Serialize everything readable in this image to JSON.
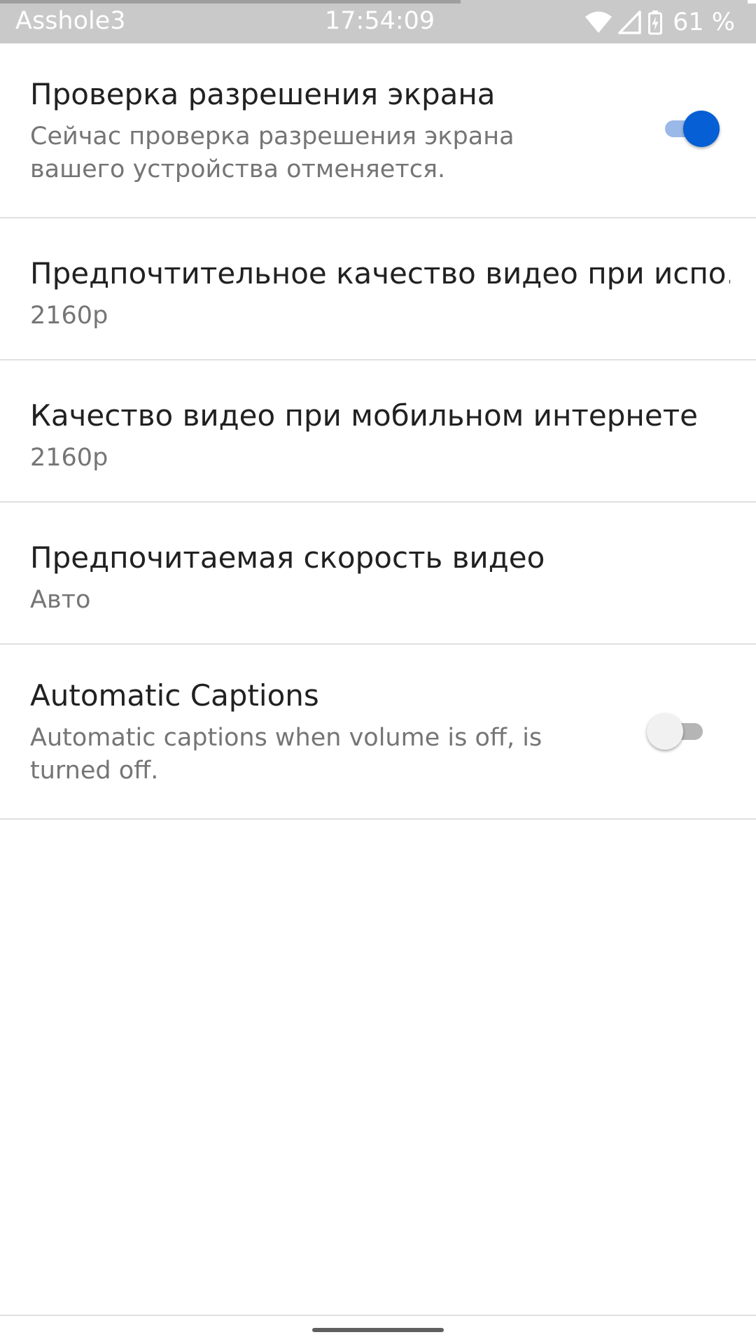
{
  "status_bar": {
    "carrier": "Asshole3",
    "time": "17:54:09",
    "battery": "61 %",
    "icons": [
      "wifi-icon",
      "cellular-signal-icon",
      "battery-charging-icon"
    ]
  },
  "settings": [
    {
      "title": "Проверка разрешения экрана",
      "subtitle": "Сейчас проверка разрешения экрана вашего устройства отменяется.",
      "toggle": "on"
    },
    {
      "title": "Предпочтительное качество видео при испо..",
      "subtitle": "2160p"
    },
    {
      "title": "Качество видео при мобильном интернете",
      "subtitle": "2160p"
    },
    {
      "title": "Предпочитаемая скорость видео",
      "subtitle": "Авто"
    },
    {
      "title": "Automatic Captions",
      "subtitle": "Automatic captions when volume is off, is turned off.",
      "toggle": "off"
    }
  ],
  "colors": {
    "accent": "#065fd4",
    "status_bar": "#c9c9c9"
  }
}
